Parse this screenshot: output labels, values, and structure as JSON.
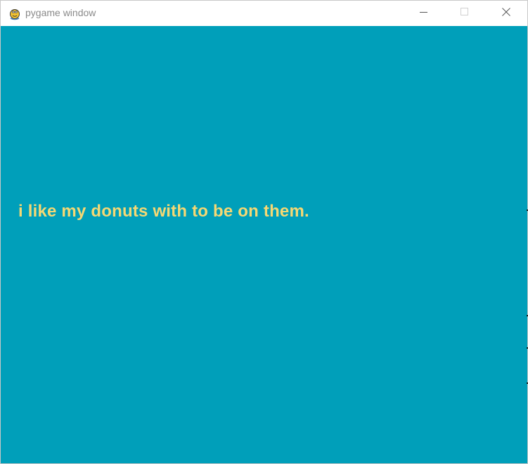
{
  "window": {
    "title": "pygame window",
    "app_icon": "pygame-snake-icon",
    "controls": {
      "minimize_icon": "minimize-icon",
      "maximize_icon": "maximize-icon",
      "close_icon": "close-icon"
    }
  },
  "canvas": {
    "background_color": "#009fba",
    "text_color": "#f5d874",
    "message": "i like my donuts with to be on them."
  }
}
